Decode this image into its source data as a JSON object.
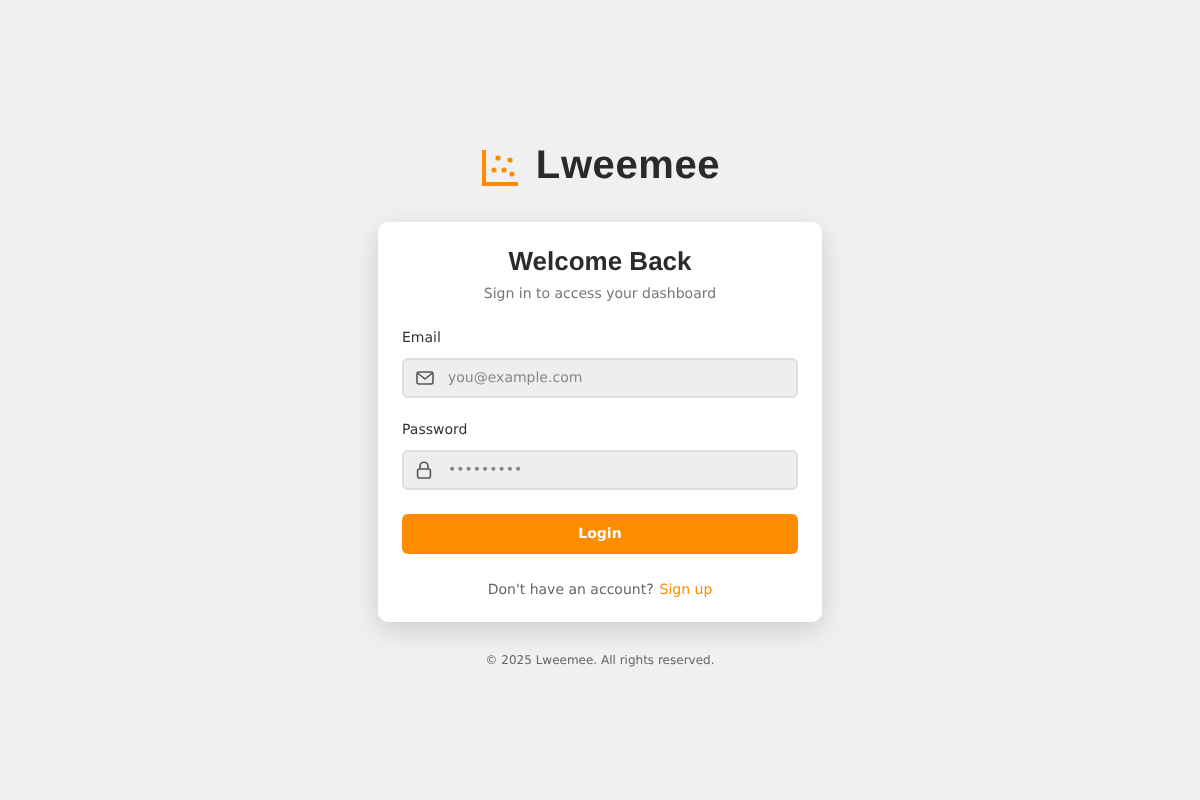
{
  "brand": {
    "name": "Lweemee"
  },
  "card": {
    "title": "Welcome Back",
    "subtitle": "Sign in to access your dashboard",
    "fields": [
      {
        "kind": "email",
        "label": "Email",
        "placeholder": "you@example.com"
      },
      {
        "kind": "password",
        "label": "Password",
        "placeholder": "•••••••••"
      }
    ],
    "submit": "Login",
    "signup_prompt": "Don't have an account?",
    "signup_link": "Sign up"
  },
  "footer": "© 2025 Lweemee. All rights reserved."
}
